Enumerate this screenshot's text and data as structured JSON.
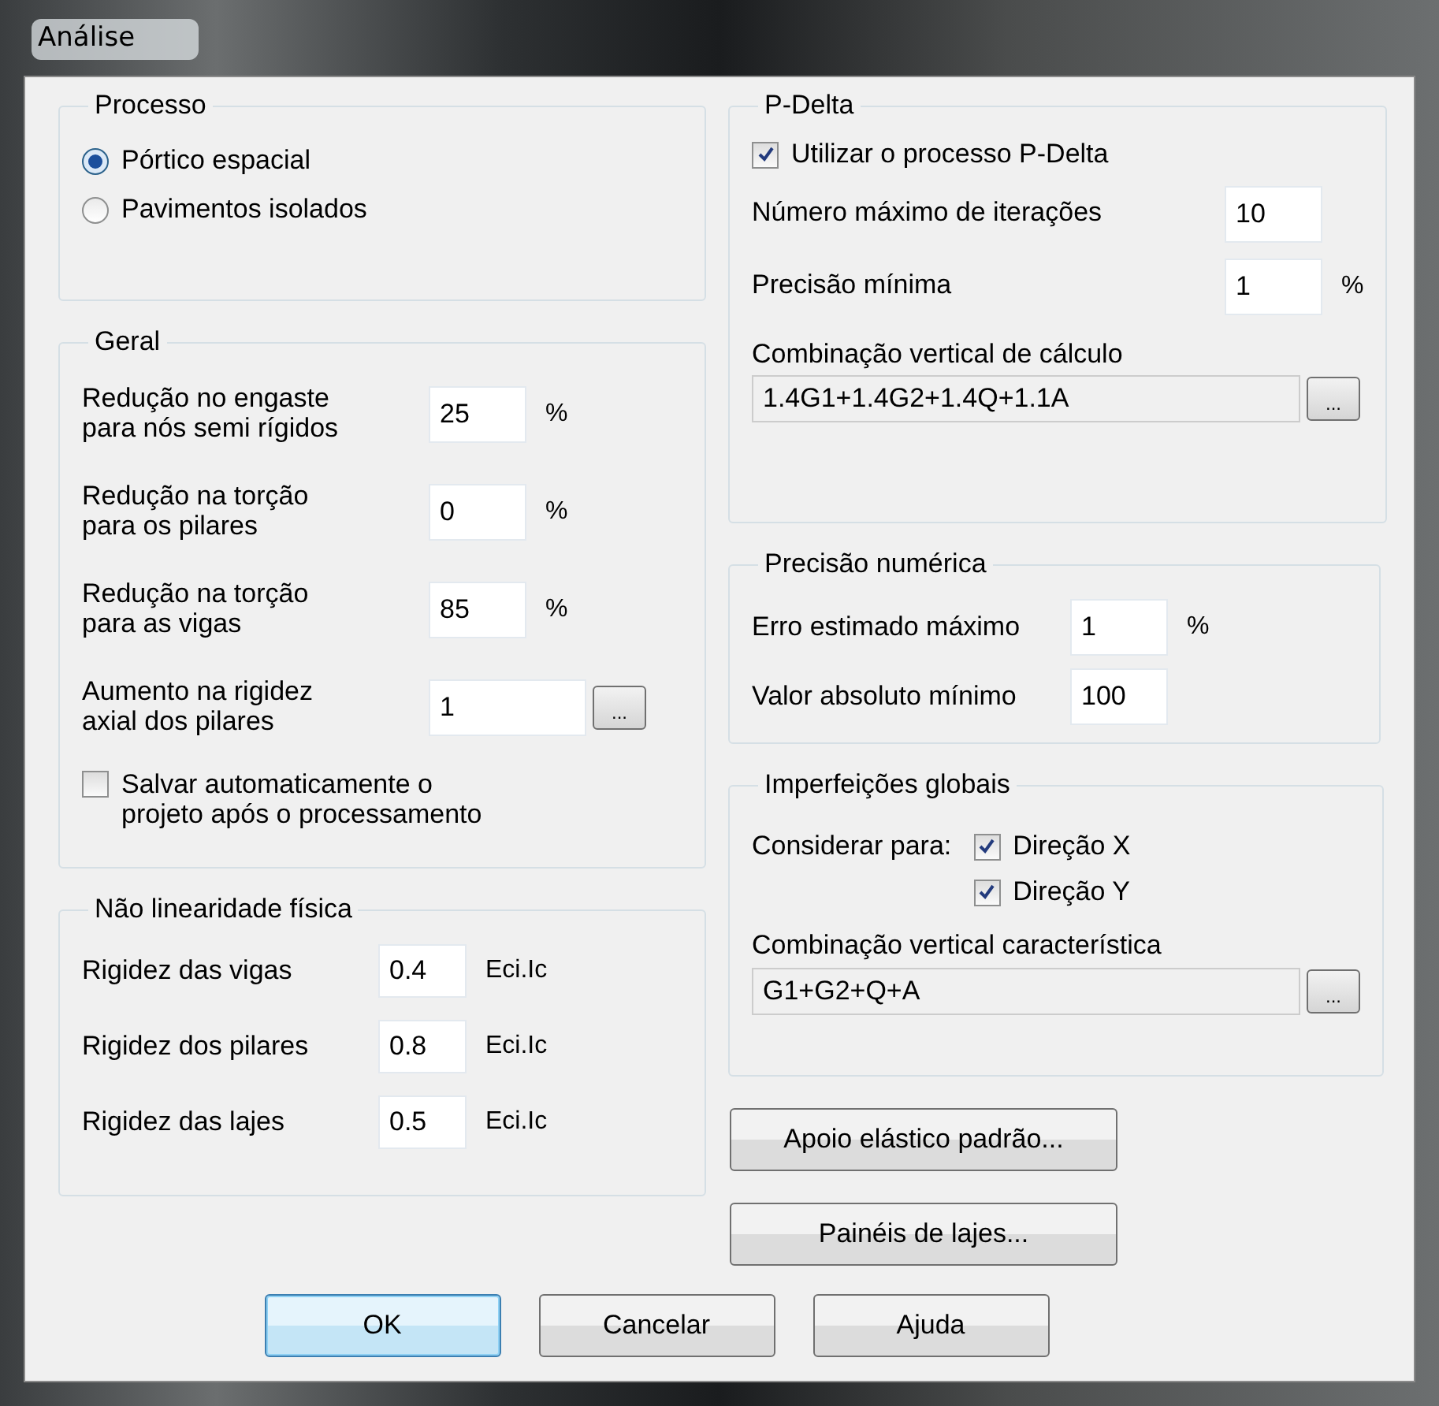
{
  "window": {
    "title": "Análise"
  },
  "processo": {
    "title": "Processo",
    "options": [
      {
        "label": "Pórtico espacial",
        "selected": true
      },
      {
        "label": "Pavimentos isolados",
        "selected": false
      }
    ]
  },
  "geral": {
    "title": "Geral",
    "fields": [
      {
        "label": "Redução no engaste\npara nós semi rígidos",
        "value": "25",
        "unit": "%"
      },
      {
        "label": "Redução na torção\npara os pilares",
        "value": "0",
        "unit": "%"
      },
      {
        "label": "Redução na torção\npara as vigas",
        "value": "85",
        "unit": "%"
      },
      {
        "label": "Aumento na rigidez\naxial dos pilares",
        "value": "1",
        "button": "..."
      }
    ],
    "checkbox": {
      "label": "Salvar automaticamente o\nprojeto após o processamento",
      "checked": false
    }
  },
  "nao_linearidade": {
    "title": "Não linearidade física",
    "fields": [
      {
        "label": "Rigidez das vigas",
        "value": "0.4",
        "unit": "Eci.Ic"
      },
      {
        "label": "Rigidez dos pilares",
        "value": "0.8",
        "unit": "Eci.Ic"
      },
      {
        "label": "Rigidez das lajes",
        "value": "0.5",
        "unit": "Eci.Ic"
      }
    ]
  },
  "p_delta": {
    "title": "P-Delta",
    "checkbox": {
      "label": "Utilizar o processo P-Delta",
      "checked": true
    },
    "fields": [
      {
        "label": "Número máximo de iterações",
        "value": "10"
      },
      {
        "label": "Precisão mínima",
        "value": "1",
        "unit": "%"
      }
    ],
    "combination": {
      "label": "Combinação vertical de cálculo",
      "value": "1.4G1+1.4G2+1.4Q+1.1A",
      "button": "..."
    }
  },
  "precisao_numerica": {
    "title": "Precisão numérica",
    "fields": [
      {
        "label": "Erro estimado máximo",
        "value": "1",
        "unit": "%"
      },
      {
        "label": "Valor absoluto mínimo",
        "value": "100"
      }
    ]
  },
  "imperfeicoes": {
    "title": "Imperfeições globais",
    "consider_label": "Considerar para:",
    "checkboxes": [
      {
        "label": "Direção X",
        "checked": true
      },
      {
        "label": "Direção Y",
        "checked": true
      }
    ],
    "combination": {
      "label": "Combinação vertical característica",
      "value": "G1+G2+Q+A",
      "button": "..."
    }
  },
  "side_buttons": [
    "Apoio elástico padrão...",
    "Painéis de lajes..."
  ],
  "buttons": [
    {
      "label": "OK",
      "default": true
    },
    {
      "label": "Cancelar",
      "default": false
    },
    {
      "label": "Ajuda",
      "default": false
    }
  ]
}
